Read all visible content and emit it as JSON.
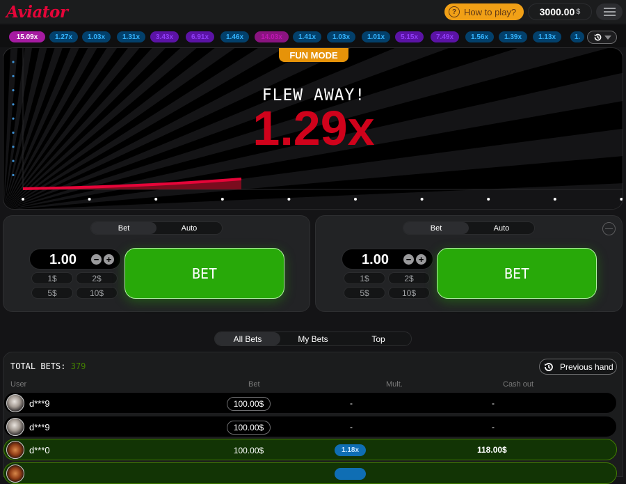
{
  "header": {
    "logo": "Aviator",
    "how_to_play": "How to play?",
    "balance": "3000.00",
    "currency": "$"
  },
  "history": {
    "multipliers": [
      {
        "value": "15.09x",
        "tier": "first"
      },
      {
        "value": "1.27x",
        "tier": "blue"
      },
      {
        "value": "1.03x",
        "tier": "blue"
      },
      {
        "value": "1.31x",
        "tier": "blue"
      },
      {
        "value": "3.43x",
        "tier": "purple"
      },
      {
        "value": "6.91x",
        "tier": "purple"
      },
      {
        "value": "1.46x",
        "tier": "blue"
      },
      {
        "value": "14.03x",
        "tier": "pink"
      },
      {
        "value": "1.41x",
        "tier": "blue"
      },
      {
        "value": "1.03x",
        "tier": "blue"
      },
      {
        "value": "1.01x",
        "tier": "blue"
      },
      {
        "value": "5.15x",
        "tier": "purple"
      },
      {
        "value": "7.49x",
        "tier": "purple"
      },
      {
        "value": "1.56x",
        "tier": "blue"
      },
      {
        "value": "1.39x",
        "tier": "blue"
      },
      {
        "value": "1.13x",
        "tier": "blue"
      },
      {
        "value": "1.",
        "tier": "blue"
      }
    ]
  },
  "game": {
    "mode_badge": "FUN MODE",
    "status": "FLEW AWAY!",
    "multiplier": "1.29x"
  },
  "bet_panels": [
    {
      "tabs": [
        "Bet",
        "Auto"
      ],
      "active_tab": "Bet",
      "amount": "1.00",
      "quick_amounts": [
        "1$",
        "2$",
        "5$",
        "10$"
      ],
      "bet_label": "BET"
    },
    {
      "tabs": [
        "Bet",
        "Auto"
      ],
      "active_tab": "Bet",
      "amount": "1.00",
      "quick_amounts": [
        "1$",
        "2$",
        "5$",
        "10$"
      ],
      "bet_label": "BET"
    }
  ],
  "bets": {
    "tabs": [
      "All Bets",
      "My Bets",
      "Top"
    ],
    "active_tab": "All Bets",
    "total_label": "TOTAL BETS:",
    "total_count": "379",
    "previous_hand": "Previous hand",
    "columns": [
      "User",
      "Bet",
      "Mult.",
      "Cash out"
    ],
    "rows": [
      {
        "user": "d***9",
        "bet": "100.00$",
        "mult": "-",
        "cashout": "-",
        "won": false,
        "avatar": "a"
      },
      {
        "user": "d***9",
        "bet": "100.00$",
        "mult": "-",
        "cashout": "-",
        "won": false,
        "avatar": "a"
      },
      {
        "user": "d***0",
        "bet": "100.00$",
        "mult": "1.18x",
        "cashout": "118.00$",
        "won": true,
        "avatar": "b"
      },
      {
        "user": "",
        "bet": "",
        "mult": "",
        "cashout": "",
        "won": true,
        "avatar": "b"
      }
    ]
  },
  "colors": {
    "brand_red": "#e50539",
    "bet_green": "#28a909",
    "fun_mode_orange": "#e69309",
    "multiplier_red": "#d0021b"
  }
}
